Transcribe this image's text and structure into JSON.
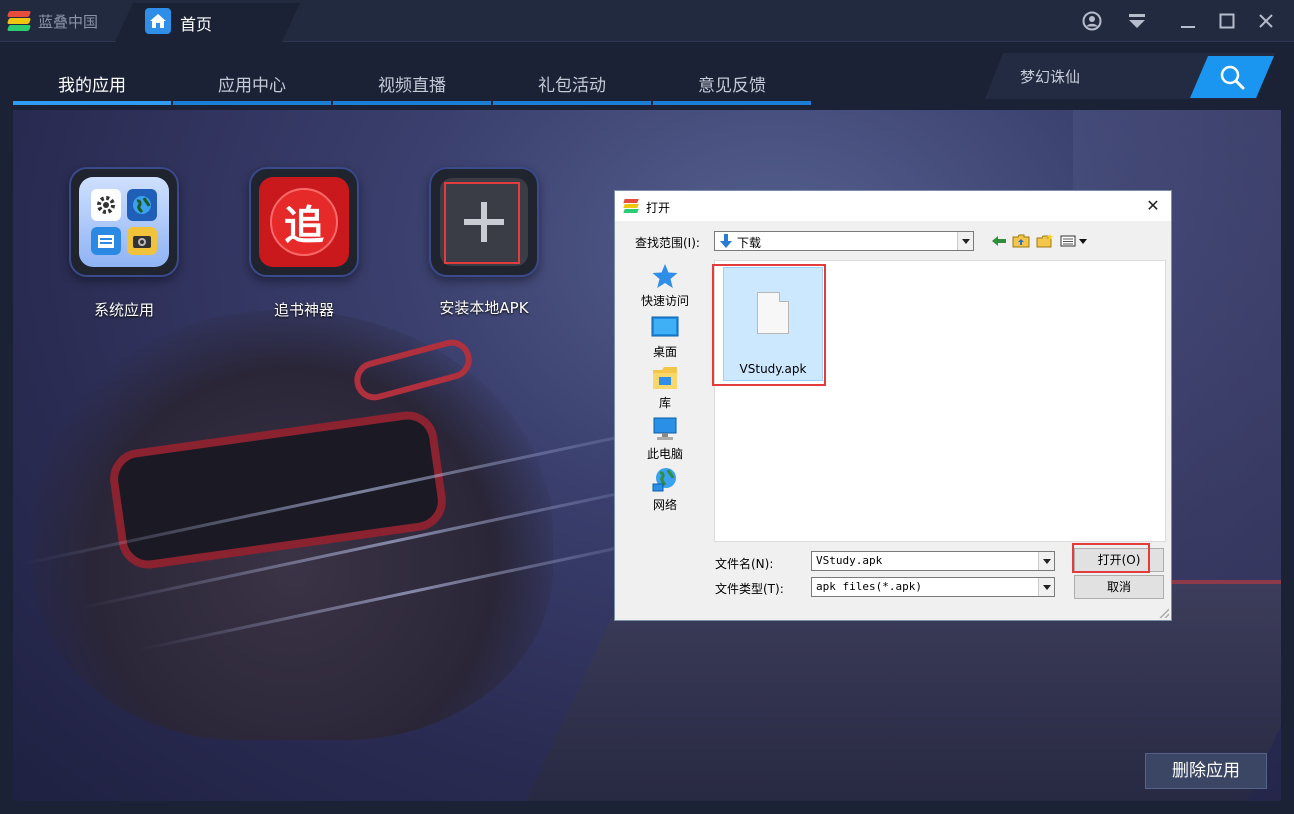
{
  "titlebar": {
    "brand_name": "蓝叠中国",
    "home_tab_label": "首页",
    "controls": [
      "user-icon",
      "download-icon",
      "minimize-icon",
      "maximize-icon",
      "close-icon"
    ]
  },
  "nav": {
    "tabs": [
      {
        "label": "我的应用",
        "active": true
      },
      {
        "label": "应用中心",
        "active": false
      },
      {
        "label": "视频直播",
        "active": false
      },
      {
        "label": "礼包活动",
        "active": false
      },
      {
        "label": "意见反馈",
        "active": false
      }
    ],
    "search_text": "梦幻诛仙",
    "accent_color": "#2f9bf2"
  },
  "apps": [
    {
      "label": "系统应用"
    },
    {
      "label": "追书神器",
      "glyph": "追"
    },
    {
      "label": "安装本地APK",
      "glyph": "+"
    }
  ],
  "delete_button_label": "删除应用",
  "dialog": {
    "title": "打开",
    "lookin_label": "查找范围(I):",
    "lookin_value": "下载",
    "places": [
      {
        "label": "快速访问",
        "icon": "star-icon"
      },
      {
        "label": "桌面",
        "icon": "desktop-icon"
      },
      {
        "label": "库",
        "icon": "library-icon"
      },
      {
        "label": "此电脑",
        "icon": "computer-icon"
      },
      {
        "label": "网络",
        "icon": "network-icon"
      }
    ],
    "files": [
      {
        "name": "VStudy.apk",
        "selected": true
      }
    ],
    "filename_label": "文件名(N):",
    "filename_value": "VStudy.apk",
    "filetype_label": "文件类型(T):",
    "filetype_value": "apk files(*.apk)",
    "open_label": "打开(O)",
    "cancel_label": "取消",
    "highlight_color": "#e23c3c"
  }
}
